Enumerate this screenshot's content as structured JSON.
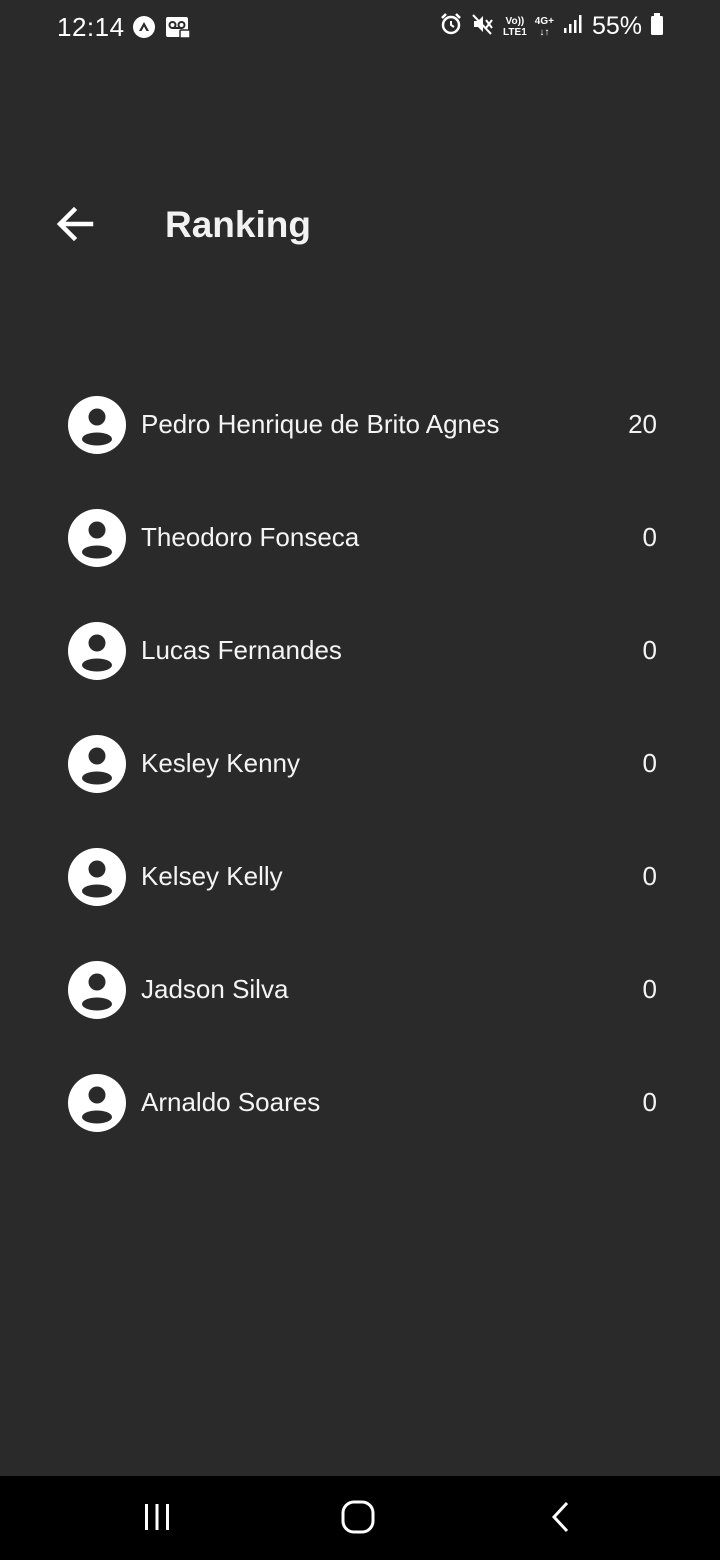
{
  "status_bar": {
    "time": "12:14",
    "battery_percent": "55%",
    "volte_top": "Vo))",
    "volte_bottom": "LTE1",
    "network_top": "4G+",
    "network_bottom": "↓↑",
    "icons": [
      "navigation-icon",
      "voicemail-icon",
      "alarm-icon",
      "mute-icon",
      "signal-icon",
      "battery-icon"
    ]
  },
  "header": {
    "title": "Ranking"
  },
  "ranking": [
    {
      "name": "Pedro Henrique de Brito Agnes",
      "score": "20"
    },
    {
      "name": "Theodoro Fonseca",
      "score": "0"
    },
    {
      "name": "Lucas Fernandes",
      "score": "0"
    },
    {
      "name": "Kesley Kenny",
      "score": "0"
    },
    {
      "name": "Kelsey Kelly",
      "score": "0"
    },
    {
      "name": "Jadson Silva",
      "score": "0"
    },
    {
      "name": "Arnaldo Soares",
      "score": "0"
    }
  ],
  "nav": {
    "buttons": [
      "recent-apps",
      "home",
      "back"
    ]
  },
  "colors": {
    "background": "#2a2a2a",
    "text": "#ffffff",
    "nav_background": "#000000"
  }
}
